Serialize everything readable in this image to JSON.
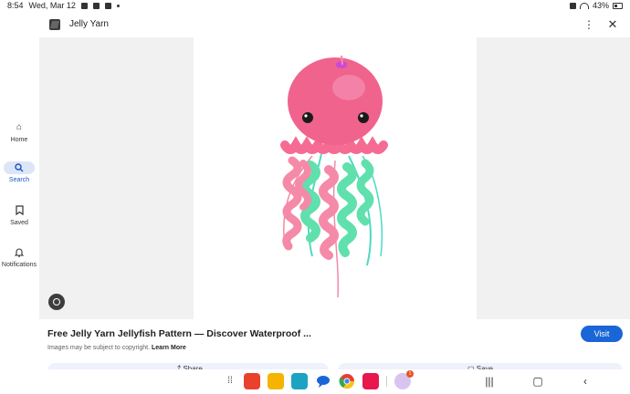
{
  "status_bar": {
    "time": "8:54",
    "date": "Wed, Mar 12",
    "battery": "43%"
  },
  "header": {
    "title": "Jelly Yarn",
    "more_icon": "more-vert-icon",
    "close_icon": "close-icon"
  },
  "nav": [
    {
      "label": "Home",
      "icon": "home-icon"
    },
    {
      "label": "Search",
      "icon": "search-icon",
      "active": true
    },
    {
      "label": "Saved",
      "icon": "bookmark-icon"
    },
    {
      "label": "Notifications",
      "icon": "bell-icon"
    }
  ],
  "result": {
    "title": "Free Jelly Yarn Jellyfish Pattern — Discover Waterproof ...",
    "copyright": "Images may be subject to copyright.",
    "learn_more": "Learn More",
    "visit_label": "Visit",
    "share_label": "Share",
    "save_label": "Save"
  },
  "taskbar": {
    "badge_count": "1"
  },
  "colors": {
    "accent": "#1a66d6",
    "jelly_pink": "#f06b8f",
    "jelly_green": "#5fe0ad"
  }
}
